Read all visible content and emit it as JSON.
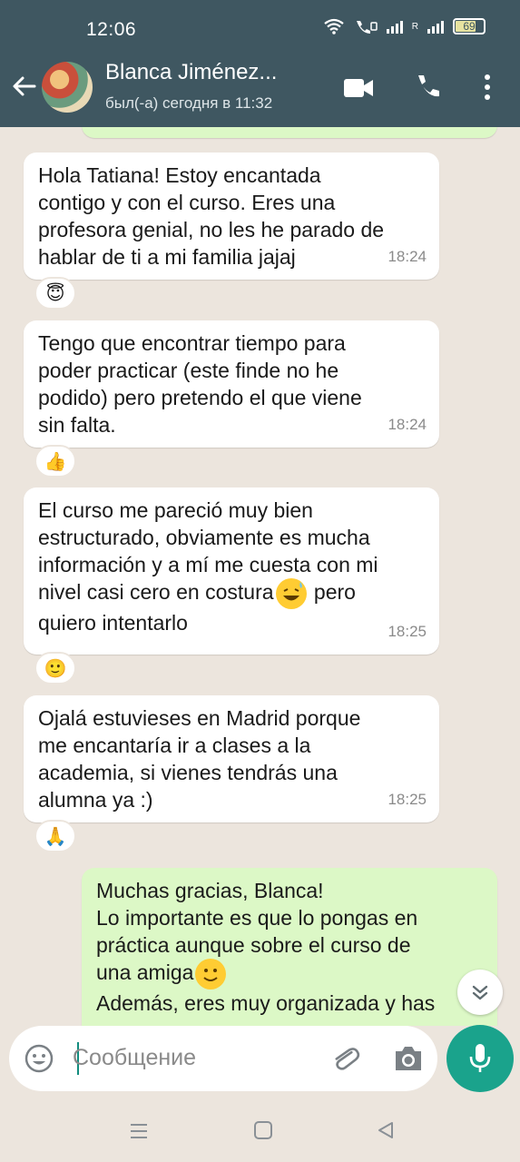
{
  "status_bar": {
    "time": "12:06",
    "battery": "69"
  },
  "header": {
    "contact_name": "Blanca Jiménez...",
    "last_seen": "был(-а) сегодня в 11:32"
  },
  "messages": [
    {
      "text": "Hola Tatiana! Estoy encantada\ncontigo y con el curso. Eres una\nprofesora genial, no les he parado de\nhablar de ti a mi familia jajaj",
      "time": "18:24",
      "reaction": "😇"
    },
    {
      "text": "Tengo que encontrar tiempo para\npoder practicar (este finde no he\npodido) pero pretendo el que viene\nsin falta.",
      "time": "18:24",
      "reaction": "👍"
    },
    {
      "text_a": "El curso me pareció muy bien\nestructurado, obviamente es mucha\ninformación y a mí me cuesta con mi\nnivel casi cero en costura",
      "text_b": " pero\nquiero intentarlo",
      "time": "18:25",
      "reaction": "🙂"
    },
    {
      "text": "Ojalá estuvieses en Madrid porque\nme encantaría ir a clases a la\nacademia, si vienes tendrás una\nalumna ya :)",
      "time": "18:25",
      "reaction": "🙏"
    },
    {
      "text_a": "Muchas gracias, Blanca!\nLo importante es que lo pongas en\npráctica aunque sobre el curso de\nuna amiga",
      "text_b": "\nAdemás, eres muy organizada y has"
    }
  ],
  "composer": {
    "placeholder": "Сообщение"
  },
  "icons": {
    "back": "back-arrow-icon",
    "video": "video-call-icon",
    "call": "phone-icon",
    "menu": "more-vert-icon",
    "emoji": "emoji-icon",
    "attach": "paperclip-icon",
    "camera": "camera-icon",
    "mic": "microphone-icon",
    "scroll": "scroll-down-icon"
  },
  "colors": {
    "header": "#3f5761",
    "accent": "#1aa38c",
    "outgoing": "#dcf8c6",
    "background": "#ece5dd"
  }
}
